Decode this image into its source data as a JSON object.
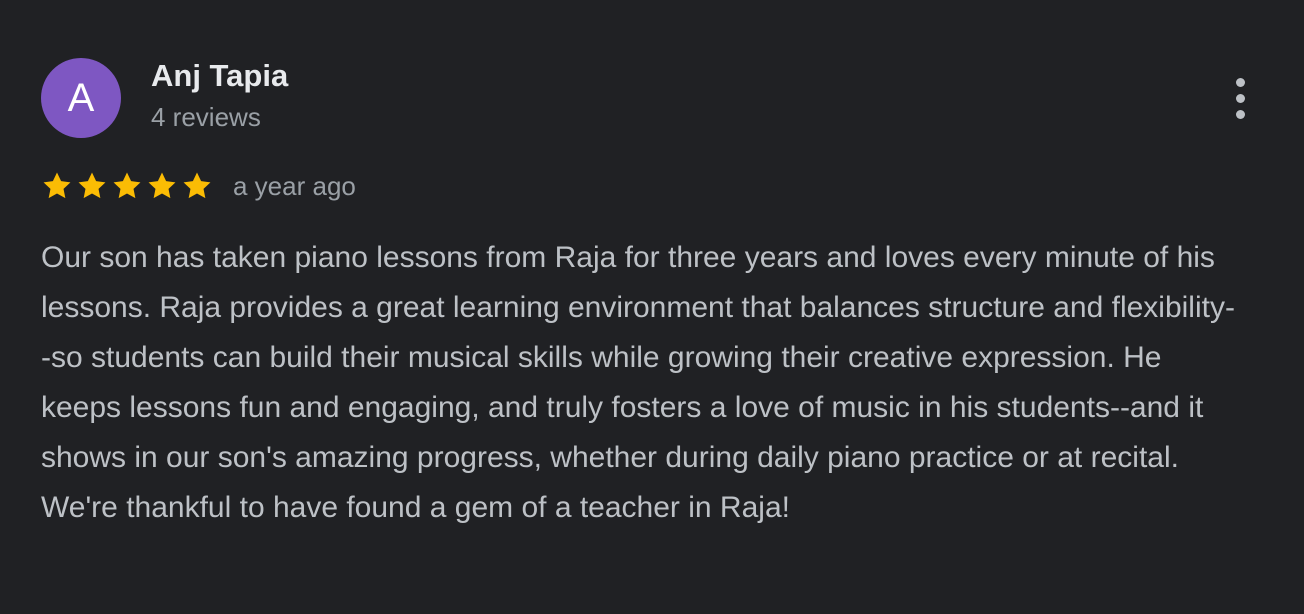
{
  "reviewer": {
    "avatar_letter": "A",
    "name": "Anj Tapia",
    "reviews_count": "4 reviews"
  },
  "rating": {
    "stars": 5,
    "max_stars": 5,
    "star_icon": "star-icon",
    "time": "a year ago"
  },
  "review": {
    "text": "Our son has taken piano lessons from Raja for three years and loves every minute of his lessons. Raja provides a great learning environment that balances structure and flexibility--so students can build their musical skills while growing their creative expression. He keeps lessons fun and engaging, and truly fosters a love of music in his students--and it shows in our son's amazing progress, whether during daily piano practice or at recital. We're thankful to have found a gem of a teacher in Raja!"
  },
  "menu": {
    "icon": "more-vert-icon"
  },
  "colors": {
    "background": "#202124",
    "avatar": "#7e57c2",
    "star": "#fbbc04",
    "name": "#e8eaed",
    "secondary_text": "#9aa0a6",
    "body_text": "#bdc1c6"
  }
}
